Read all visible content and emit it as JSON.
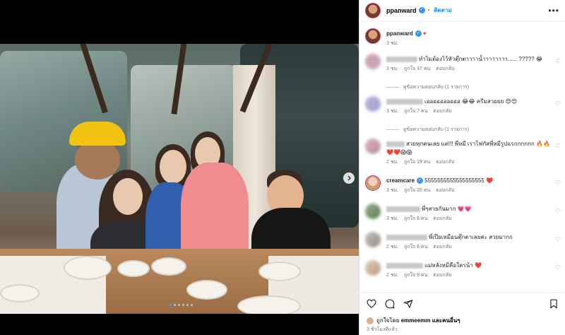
{
  "post": {
    "username": "ppanward",
    "follow_label": "ติดตาม",
    "more_icon": "more-horizontal-icon",
    "caption_emoji": "♥",
    "caption_time": "3 ชม."
  },
  "comments": [
    {
      "text": "ทำไมต้องไว้หัวตุ๊กตาาาาน้ำาาาาาาา...... ????? 😂",
      "time": "3 ชม.",
      "likes": "ถูกใจ 37 คน",
      "reply": "ตอบกลับ",
      "replies": "ดูข้อความตอบกลับ (1 รายการ)"
    },
    {
      "text": "เออออออออออ 😂😂 ครีมสวยยย 😍😍",
      "time": "3 ชม.",
      "likes": "ถูกใจ 7 คน",
      "reply": "ตอบกลับ",
      "replies": "ดูข้อความตอบกลับ (1 รายการ)"
    },
    {
      "text": "สวยทุกคนเลย แต่!!! พี่หมี เราโฟกัสพี่หมีรูปแรกกกกกก 🔥🔥 ❤️❤️😱😱",
      "time": "2 ชม.",
      "likes": "ถูกใจ 19 คน",
      "reply": "ตอบกลับ"
    },
    {
      "user": "creamcare",
      "text": "5555555555555555555 ❤️",
      "time": "3 ชม.",
      "likes": "ถูกใจ 26 คน",
      "reply": "ตอบกลับ"
    },
    {
      "text": "พี่ๆสวยกันมาก 💗💗",
      "time": "3 ชม.",
      "likes": "ถูกใจ 8 คน",
      "reply": "ตอบกลับ"
    },
    {
      "text": "พี่เป๊ยเหมือนตุ๊กตาเลยค่ะ สวยมากก",
      "time": "2 ชม.",
      "likes": "ถูกใจ 8 คน",
      "reply": "ตอบกลับ"
    },
    {
      "text": "แม่หลังหมีคือใครน้า ❤️",
      "time": "2 ชม.",
      "likes": "ถูกใจ 9 คน",
      "reply": "ตอบกลับ"
    }
  ],
  "footer": {
    "liked_by_prefix": "ถูกใจโดย",
    "liked_by_user": "emmeemm",
    "liked_by_suffix": "และคนอื่นๆ",
    "time": "3 ชั่วโมงที่แล้ว"
  },
  "icons": {
    "like": "heart-icon",
    "comment": "comment-icon",
    "share": "share-icon",
    "save": "bookmark-icon",
    "next": "chevron-right-icon"
  },
  "carousel": {
    "total": 6,
    "active": 1
  },
  "colors": {
    "link": "#0095f6",
    "verified": "#3897f0",
    "muted": "#737373"
  }
}
